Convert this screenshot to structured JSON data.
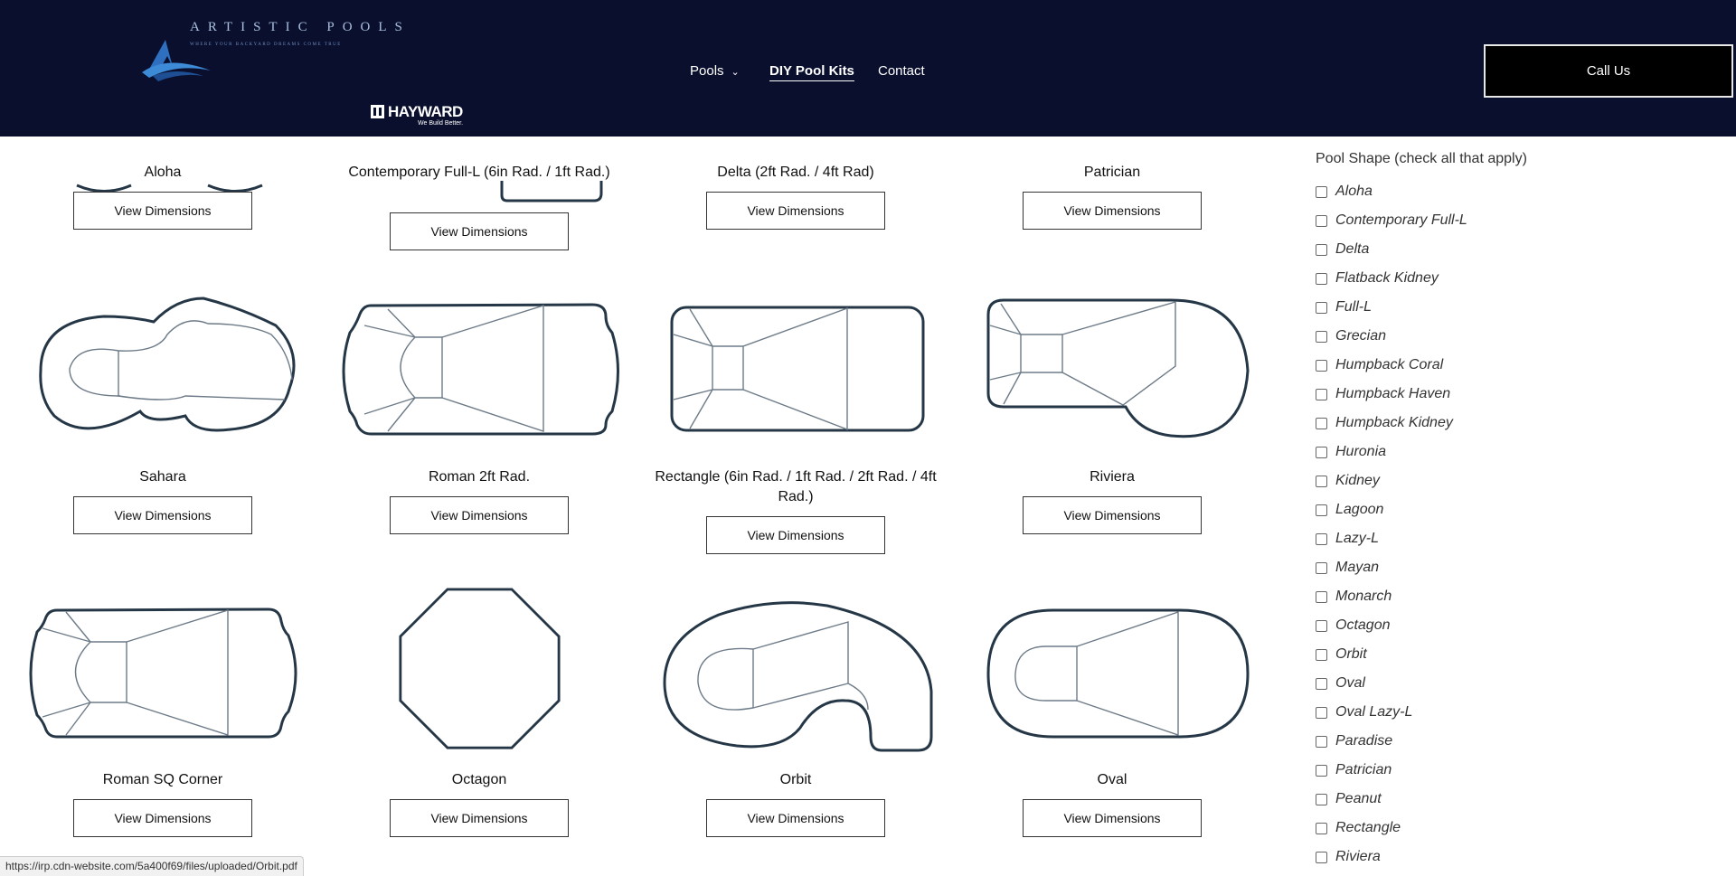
{
  "header": {
    "logo_title": "ARTISTIC POOLS",
    "logo_tagline": "WHERE YOUR BACKYARD DREAMS COME TRUE",
    "partner_logo": "HAYWARD",
    "partner_tagline": "We Build Better.",
    "nav": [
      {
        "label": "Pools"
      },
      {
        "label": "DIY Pool Kits"
      },
      {
        "label": "Contact"
      }
    ],
    "call_label": "Call Us"
  },
  "view_label": "View Dimensions",
  "pools": [
    {
      "name": "Aloha"
    },
    {
      "name": "Contemporary Full-L (6in Rad. / 1ft Rad.)"
    },
    {
      "name": "Delta (2ft Rad. / 4ft Rad)"
    },
    {
      "name": "Patrician"
    },
    {
      "name": "Sahara"
    },
    {
      "name": "Roman 2ft Rad."
    },
    {
      "name": "Rectangle (6in Rad. / 1ft Rad. / 2ft Rad. / 4ft Rad.)"
    },
    {
      "name": "Riviera"
    },
    {
      "name": "Roman SQ Corner"
    },
    {
      "name": "Octagon"
    },
    {
      "name": "Orbit"
    },
    {
      "name": "Oval"
    }
  ],
  "filter": {
    "title": "Pool Shape (check all that apply)",
    "options": [
      "Aloha",
      "Contemporary Full-L",
      "Delta",
      "Flatback Kidney",
      "Full-L",
      "Grecian",
      "Humpback Coral",
      "Humpback Haven",
      "Humpback Kidney",
      "Huronia",
      "Kidney",
      "Lagoon",
      "Lazy-L",
      "Mayan",
      "Monarch",
      "Octagon",
      "Orbit",
      "Oval",
      "Oval Lazy-L",
      "Paradise",
      "Patrician",
      "Peanut",
      "Rectangle",
      "Riviera"
    ]
  },
  "status_url": "https://irp.cdn-website.com/5a400f69/files/uploaded/Orbit.pdf"
}
